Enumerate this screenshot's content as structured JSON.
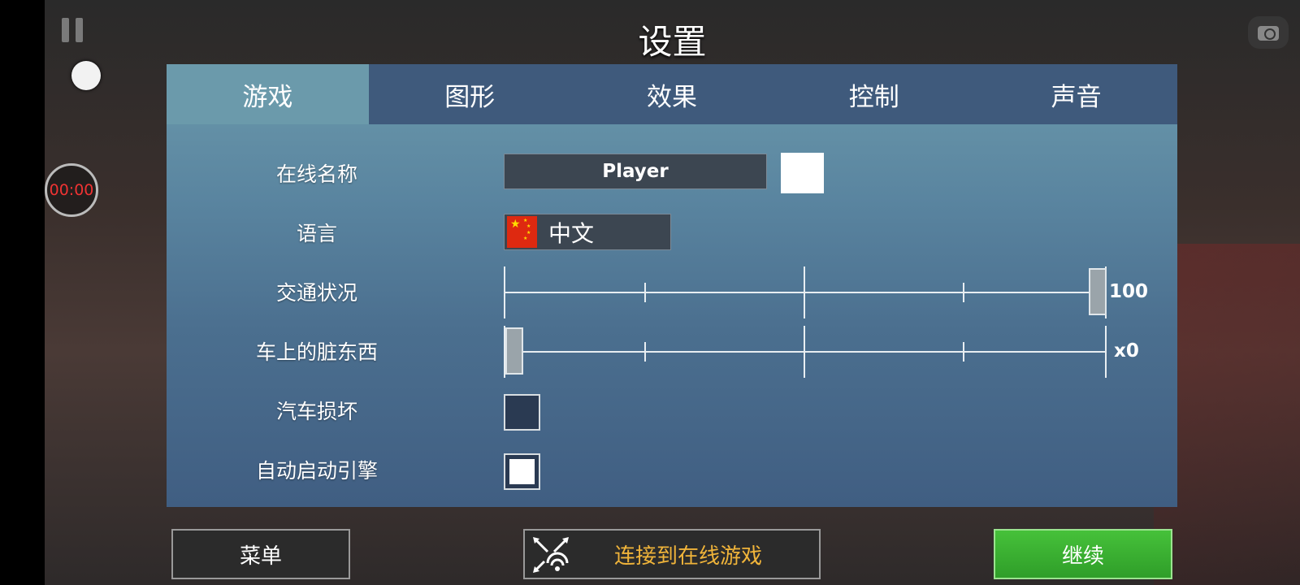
{
  "title": "设置",
  "hud": {
    "timer": "00:00"
  },
  "tabs": [
    {
      "label": "游戏",
      "active": true
    },
    {
      "label": "图形",
      "active": false
    },
    {
      "label": "效果",
      "active": false
    },
    {
      "label": "控制",
      "active": false
    },
    {
      "label": "声音",
      "active": false
    }
  ],
  "settings": {
    "online_name": {
      "label": "在线名称",
      "value": "Player",
      "color": "#ffffff"
    },
    "language": {
      "label": "语言",
      "value": "中文",
      "flag_icon": "china-flag-icon"
    },
    "traffic": {
      "label": "交通状况",
      "value": "100",
      "level": 1.0
    },
    "car_dirt": {
      "label": "车上的脏东西",
      "value": "x0",
      "level": 0.0
    },
    "car_damage": {
      "label": "汽车损坏",
      "checked": false
    },
    "auto_start_engine": {
      "label": "自动启动引擎",
      "checked": true
    }
  },
  "buttons": {
    "menu": "菜单",
    "connect_online": "连接到在线游戏",
    "continue": "继续"
  },
  "colors": {
    "tab_active": "#6b9aab",
    "tab_bar": "#3f5a7c",
    "online_text": "#f0b43a",
    "continue_green": "#3fb334"
  }
}
